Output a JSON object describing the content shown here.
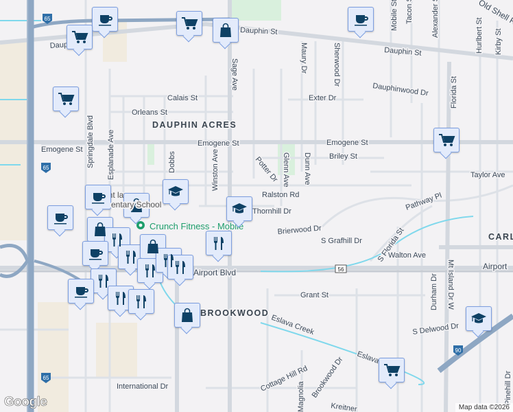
{
  "map": {
    "areas": [
      "DAUPHIN ACRES",
      "BROOKWOOD",
      "CARL"
    ],
    "poi": {
      "name": "Crunch Fitness - Mobile",
      "school_line1": "cent lawn",
      "school_line2": "entary School"
    },
    "streets": [
      "Dauphin St",
      "Dauphin St",
      "Dauphi",
      "Calais St",
      "Orleans St",
      "Emogene St",
      "Emogene St",
      "Emogene St",
      "Exter Dr",
      "Dauphinwood Dr",
      "Briley St",
      "Taylor Ave",
      "Ralston Rd",
      "Thornhill Dr",
      "Brierwood Dr",
      "S Grafhill Dr",
      "Pathway Pl",
      "S Florida St",
      "Walton Ave",
      "Airport Blvd",
      "Airport",
      "Grant St",
      "Durham Dr",
      "S Delwood Dr",
      "Eslava Creek",
      "Eslava Creek",
      "Cottage Hill Rd",
      "Brookwood Dr",
      "International Dr",
      "Magnolia",
      "Kreitner",
      "Pinehill Dr",
      "Springdale Blvd",
      "Esplanade Ave",
      "Dobbs",
      "Winston Ave",
      "Sage Ave",
      "Potter Dr",
      "Glenn Ave",
      "Dunn Ave",
      "Maury Dr",
      "Sherwood Dr",
      "Mobile St",
      "Tacon St",
      "Alexander St",
      "Hurlbert St",
      "Kirby St",
      "Old Shell Rd",
      "Florida St",
      "Mt Island Dr W"
    ],
    "shields": [
      "65",
      "65",
      "65",
      "56",
      "90"
    ],
    "markers": [
      "coffee",
      "cart",
      "cart",
      "bag",
      "coffee",
      "cart",
      "cart",
      "coffee",
      "coffee",
      "bag",
      "graduation-cap",
      "graduation-cap",
      "bag",
      "fork-knife",
      "coffee",
      "fork-knife",
      "bag",
      "fork-knife",
      "fork-knife",
      "fork-knife",
      "fork-knife",
      "fork-knife",
      "coffee",
      "fork-knife",
      "fork-knife",
      "bag",
      "graduation-cap",
      "cart"
    ],
    "marker_color": "#0e4165",
    "logo": "Google",
    "attribution": "Map data ©2026"
  }
}
